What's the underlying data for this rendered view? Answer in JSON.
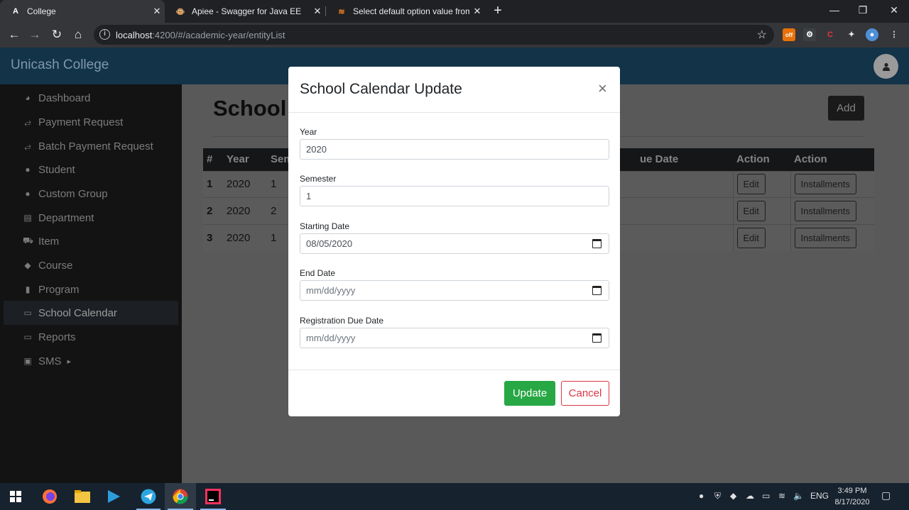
{
  "browser": {
    "tabs": [
      {
        "title": "College",
        "favicon": "A",
        "active": true
      },
      {
        "title": "Apiee - Swagger for Java EE",
        "favicon": "🐵",
        "active": false
      },
      {
        "title": "Select default option value from",
        "favicon": "≋",
        "active": false
      }
    ],
    "url_host": "localhost",
    "url_path": ":4200/#/academic-year/entityList",
    "extension_badge": "off"
  },
  "app": {
    "brand": "Unicash College",
    "sidebar": [
      {
        "label": "Dashboard",
        "icon": "dashboard-icon",
        "glyph": "◕"
      },
      {
        "label": "Payment Request",
        "icon": "exchange-icon",
        "glyph": "⥄"
      },
      {
        "label": "Batch Payment Request",
        "icon": "exchange-icon",
        "glyph": "⥄"
      },
      {
        "label": "Student",
        "icon": "user-icon",
        "glyph": "●"
      },
      {
        "label": "Custom Group",
        "icon": "user-icon",
        "glyph": "●"
      },
      {
        "label": "Department",
        "icon": "department-icon",
        "glyph": "▤"
      },
      {
        "label": "Item",
        "icon": "cart-icon",
        "glyph": "⛟"
      },
      {
        "label": "Course",
        "icon": "graduation-cap-icon",
        "glyph": "◆"
      },
      {
        "label": "Program",
        "icon": "book-icon",
        "glyph": "▮"
      },
      {
        "label": "School Calendar",
        "icon": "calendar-icon",
        "glyph": "▭"
      },
      {
        "label": "Reports",
        "icon": "calendar-icon",
        "glyph": "▭"
      },
      {
        "label": "SMS",
        "icon": "money-icon",
        "glyph": "▣",
        "caret": "▸"
      }
    ],
    "active_sidebar_item": "School Calendar",
    "page_title": "School C",
    "add_label": "Add",
    "table": {
      "headers": [
        "#",
        "Year",
        "Sem",
        "ue Date",
        "Action",
        "Action"
      ],
      "rows": [
        {
          "num": "1",
          "year": "2020",
          "sem": "1",
          "edit": "Edit",
          "installments": "Installments"
        },
        {
          "num": "2",
          "year": "2020",
          "sem": "2",
          "edit": "Edit",
          "installments": "Installments"
        },
        {
          "num": "3",
          "year": "2020",
          "sem": "1",
          "edit": "Edit",
          "installments": "Installments"
        }
      ]
    }
  },
  "modal": {
    "title": "School Calendar Update",
    "close": "×",
    "fields": {
      "year": {
        "label": "Year",
        "value": "2020"
      },
      "semester": {
        "label": "Semester",
        "value": "1"
      },
      "starting_date": {
        "label": "Starting Date",
        "value": "08/05/2020"
      },
      "end_date": {
        "label": "End Date",
        "placeholder": "mm/dd/yyyy"
      },
      "registration_due_date": {
        "label": "Registration Due Date",
        "placeholder": "mm/dd/yyyy"
      }
    },
    "update_label": "Update",
    "cancel_label": "Cancel"
  },
  "taskbar": {
    "language": "ENG",
    "time": "3:49 PM",
    "date": "8/17/2020"
  },
  "colors": {
    "header": "#123348",
    "sidebar": "#131313",
    "update_button": "#28a745",
    "cancel_button": "#dc3545"
  }
}
